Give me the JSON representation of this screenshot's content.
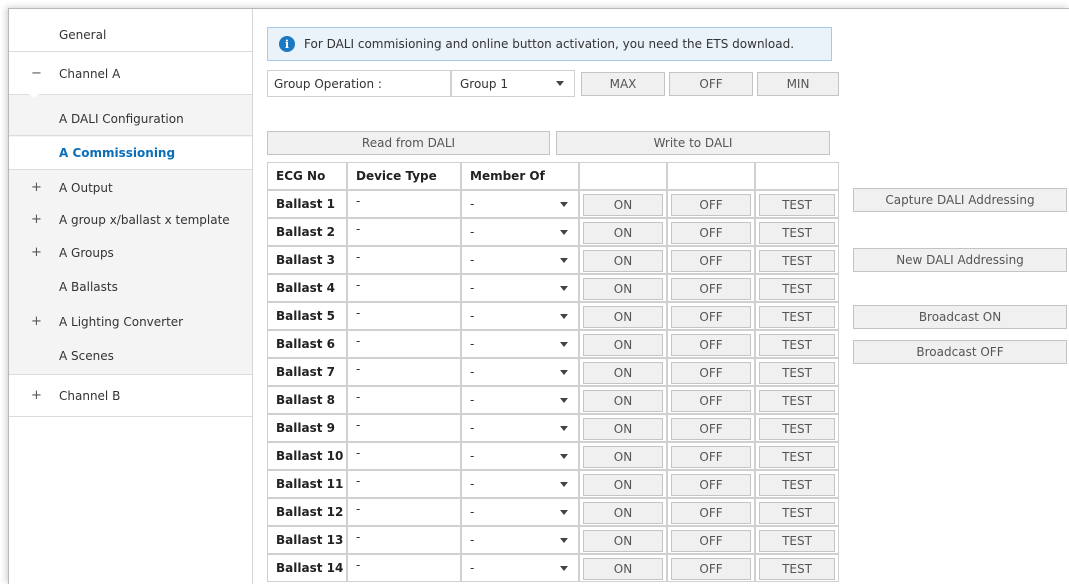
{
  "sidebar": {
    "items": [
      {
        "label": "General",
        "sign": ""
      },
      {
        "label": "Channel A",
        "sign": "−"
      },
      {
        "label": "A DALI Configuration",
        "sign": ""
      },
      {
        "label": "A Commissioning",
        "sign": ""
      },
      {
        "label": "A Output",
        "sign": "+"
      },
      {
        "label": "A group x/ballast x template",
        "sign": "+"
      },
      {
        "label": "A Groups",
        "sign": "+"
      },
      {
        "label": "A Ballasts",
        "sign": ""
      },
      {
        "label": "A Lighting Converter",
        "sign": "+"
      },
      {
        "label": "A Scenes",
        "sign": ""
      },
      {
        "label": "Channel B",
        "sign": "+"
      }
    ]
  },
  "info": {
    "text": "For DALI commisioning and online button activation, you need the ETS download.",
    "icon": "info-icon"
  },
  "group_op": {
    "label": "Group Operation :",
    "selected": "Group 1",
    "max_label": "MAX",
    "off_label": "OFF",
    "min_label": "MIN"
  },
  "actions": {
    "read_label": "Read from DALI",
    "write_label": "Write to DALI"
  },
  "table": {
    "headers": [
      "ECG No",
      "Device Type",
      "Member Of",
      "",
      "",
      ""
    ],
    "on_label": "ON",
    "off_label": "OFF",
    "test_label": "TEST",
    "rows": [
      {
        "name": "Ballast 1",
        "device": "-",
        "member": "-"
      },
      {
        "name": "Ballast 2",
        "device": "-",
        "member": "-"
      },
      {
        "name": "Ballast 3",
        "device": "-",
        "member": "-"
      },
      {
        "name": "Ballast 4",
        "device": "-",
        "member": "-"
      },
      {
        "name": "Ballast 5",
        "device": "-",
        "member": "-"
      },
      {
        "name": "Ballast 6",
        "device": "-",
        "member": "-"
      },
      {
        "name": "Ballast 7",
        "device": "-",
        "member": "-"
      },
      {
        "name": "Ballast 8",
        "device": "-",
        "member": "-"
      },
      {
        "name": "Ballast 9",
        "device": "-",
        "member": "-"
      },
      {
        "name": "Ballast 10",
        "device": "-",
        "member": "-"
      },
      {
        "name": "Ballast 11",
        "device": "-",
        "member": "-"
      },
      {
        "name": "Ballast 12",
        "device": "-",
        "member": "-"
      },
      {
        "name": "Ballast 13",
        "device": "-",
        "member": "-"
      },
      {
        "name": "Ballast 14",
        "device": "-",
        "member": "-"
      }
    ]
  },
  "side_buttons": {
    "capture": "Capture DALI Addressing",
    "new": "New DALI Addressing",
    "broadcast_on": "Broadcast ON",
    "broadcast_off": "Broadcast OFF"
  },
  "colors": {
    "accent": "#0a6fb8",
    "info_bg": "#eaf2fa",
    "info_border": "#a9c9e6"
  }
}
